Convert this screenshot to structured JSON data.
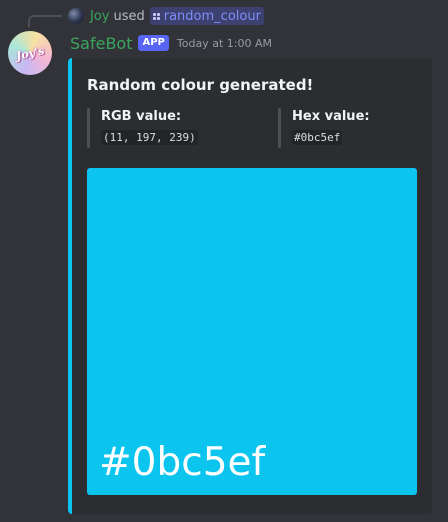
{
  "reply": {
    "user": "Joy",
    "verb": "used",
    "command": "random_colour"
  },
  "message": {
    "avatar_text": "Joy's",
    "author": "SafeBot",
    "badge": "APP",
    "timestamp": "Today at 1:00 AM"
  },
  "embed": {
    "accent_color": "#0bc5ef",
    "title": "Random colour generated!",
    "fields": [
      {
        "name": "RGB value:",
        "value": "(11, 197, 239)"
      },
      {
        "name": "Hex value:",
        "value": "#0bc5ef"
      }
    ],
    "swatch": {
      "color": "#0bc5ef",
      "label": "#0bc5ef"
    }
  }
}
